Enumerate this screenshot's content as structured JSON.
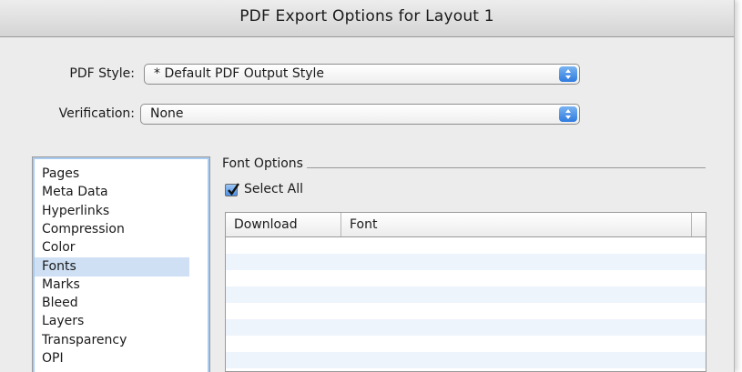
{
  "window": {
    "title": "PDF Export Options for Layout 1"
  },
  "pdf_style": {
    "label": "PDF Style:",
    "value": "* Default PDF Output Style"
  },
  "verification": {
    "label": "Verification:",
    "value": "None"
  },
  "categories": [
    "Pages",
    "Meta Data",
    "Hyperlinks",
    "Compression",
    "Color",
    "Fonts",
    "Marks",
    "Bleed",
    "Layers",
    "Transparency",
    "OPI"
  ],
  "selected_category": "Fonts",
  "font_options": {
    "group_title": "Font Options",
    "select_all_label": "Select All",
    "select_all_checked": true,
    "columns": [
      "Download",
      "Font"
    ],
    "rows": []
  },
  "colors": {
    "accent": "#2f7be0",
    "selection": "#cfe0f4"
  },
  "icons": {
    "popup_arrows": "up-down-arrows-icon",
    "checkmark": "checkmark-icon"
  }
}
